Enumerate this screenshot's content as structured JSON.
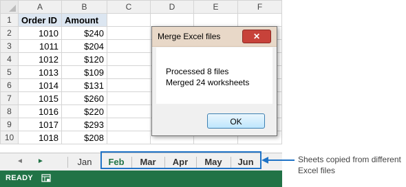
{
  "grid": {
    "columns": [
      "A",
      "B",
      "C",
      "D",
      "E",
      "F"
    ],
    "rows": [
      {
        "num": "1",
        "a": "Order ID",
        "b": "Amount"
      },
      {
        "num": "2",
        "a": "1010",
        "b": "$240"
      },
      {
        "num": "3",
        "a": "1011",
        "b": "$204"
      },
      {
        "num": "4",
        "a": "1012",
        "b": "$120"
      },
      {
        "num": "5",
        "a": "1013",
        "b": "$109"
      },
      {
        "num": "6",
        "a": "1014",
        "b": "$131"
      },
      {
        "num": "7",
        "a": "1015",
        "b": "$260"
      },
      {
        "num": "8",
        "a": "1016",
        "b": "$220"
      },
      {
        "num": "9",
        "a": "1017",
        "b": "$293"
      },
      {
        "num": "10",
        "a": "1018",
        "b": "$208"
      }
    ]
  },
  "dialog": {
    "title": "Merge Excel files",
    "close_label": "✕",
    "line1": "Processed 8 files",
    "line2": "Merged 24 worksheets",
    "ok_label": "OK"
  },
  "tabs": [
    {
      "label": "Jan",
      "active": false
    },
    {
      "label": "Feb",
      "active": true
    },
    {
      "label": "Mar",
      "active": false
    },
    {
      "label": "Apr",
      "active": false
    },
    {
      "label": "May",
      "active": false
    },
    {
      "label": "Jun",
      "active": false
    }
  ],
  "tab_nav": {
    "prev_icon": "◄",
    "next_icon": "►"
  },
  "annotation": "Sheets copied from different Excel files",
  "status": {
    "ready": "READY"
  },
  "colors": {
    "accent": "#217346",
    "highlight": "#1f73c6"
  }
}
